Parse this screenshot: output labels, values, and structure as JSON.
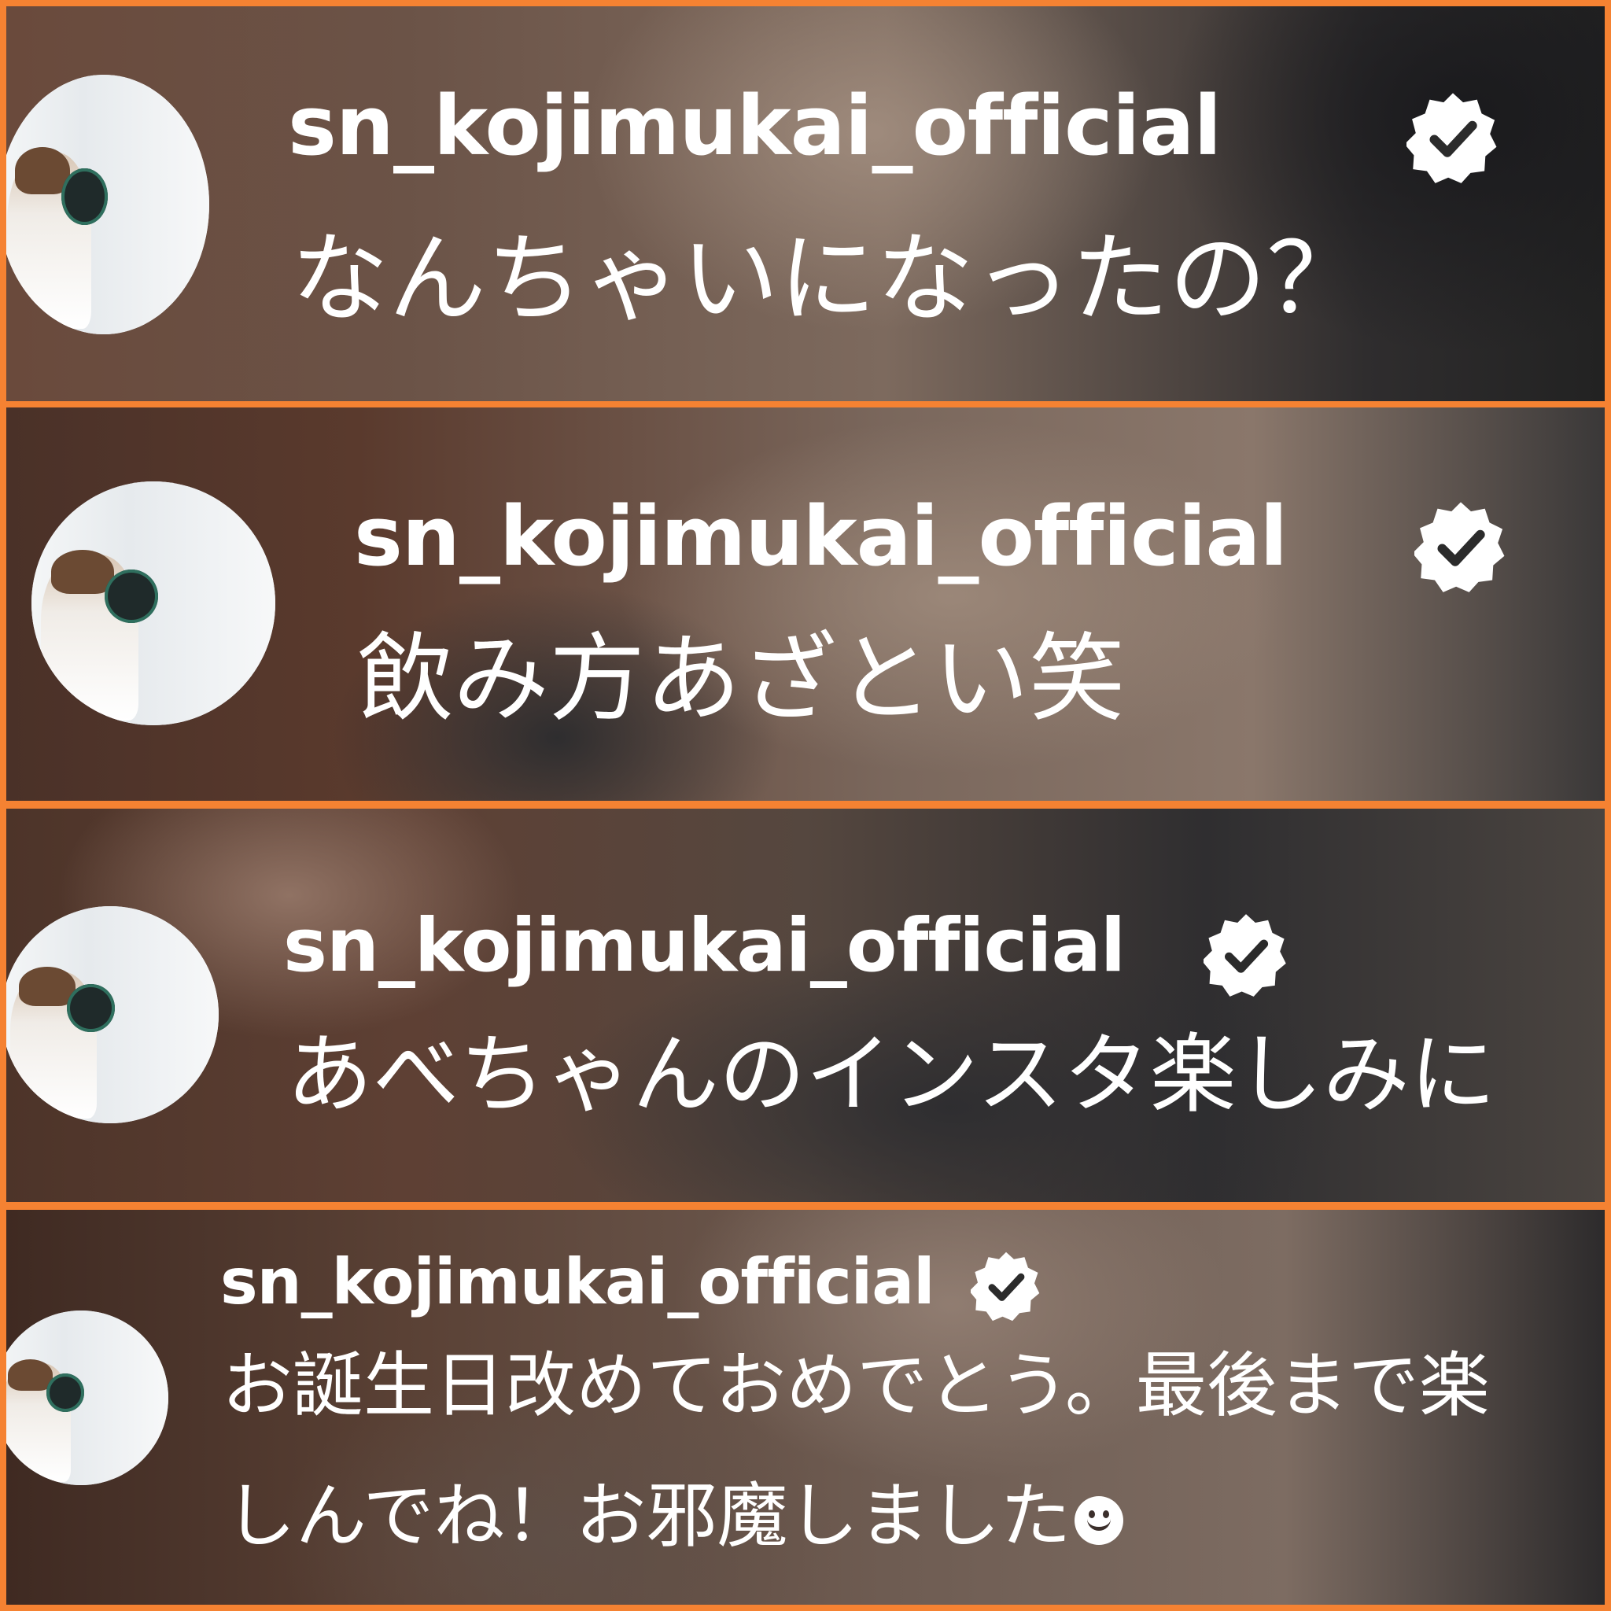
{
  "comments": [
    {
      "username": "sn_kojimukai_official",
      "verified": true,
      "text": "なんちゃいになったの？",
      "continuation": ""
    },
    {
      "username": "sn_kojimukai_official",
      "verified": true,
      "text": "飲み方あざとい笑",
      "continuation": ""
    },
    {
      "username": "sn_kojimukai_official",
      "verified": true,
      "text": "あべちゃんのインスタ楽しみに",
      "continuation": ""
    },
    {
      "username": "sn_kojimukai_official",
      "verified": true,
      "text": "お誕生日改めておめでとう。最後まで楽",
      "continuation": "しんでね！お邪魔しました"
    }
  ],
  "colors": {
    "border": "#f58232",
    "text": "#ffffff",
    "badge_check": "#2b2b2b"
  },
  "icons": {
    "verified": "verified-badge-icon",
    "emoji": "smiley-face-icon"
  }
}
